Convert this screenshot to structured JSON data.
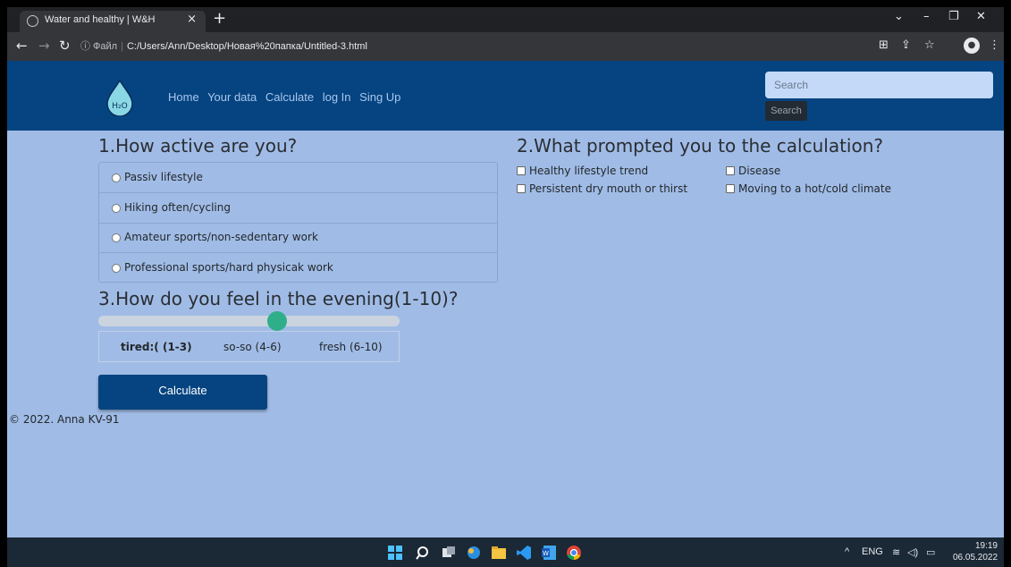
{
  "browser": {
    "tab_title": "Water and healthy | W&H",
    "tab_close": "×",
    "new_tab": "+",
    "address_info": "ⓘ Файл",
    "address_url": "C:/Users/Ann/Desktop/Новая%20папка/Untitled-3.html"
  },
  "site": {
    "logo_text": "H₂O",
    "nav": [
      "Home",
      "Your data",
      "Calculate",
      "log In",
      "Sing Up"
    ],
    "search_placeholder": "Search",
    "search_button": "Search"
  },
  "q1": {
    "title": "1.How active are you?",
    "options": [
      "Passiv lifestyle",
      "Hiking often/cycling",
      "Amateur sports/non-sedentary work",
      "Professional sports/hard physicak work"
    ]
  },
  "q2": {
    "title": "2.What prompted you to the calculation?",
    "options": [
      "Healthy lifestyle trend",
      "Disease",
      "Persistent dry mouth or thirst",
      "Moving to a hot/cold climate"
    ]
  },
  "q3": {
    "title": "3.How do you feel in the evening(1-10)?",
    "slider_value": 6,
    "slider_max": 10,
    "scale": [
      "tired:( (1-3)",
      "so-so (4-6)",
      "fresh (6-10)"
    ]
  },
  "calculate_button": "Calculate",
  "footer": "© 2022. Anna KV-91",
  "taskbar": {
    "tray_language": "ENG",
    "time": "19:19",
    "date": "06.05.2022"
  },
  "colors": {
    "nav_bg": "#054480",
    "page_bg": "#a0bce6",
    "slider_thumb": "#2fae8a"
  }
}
